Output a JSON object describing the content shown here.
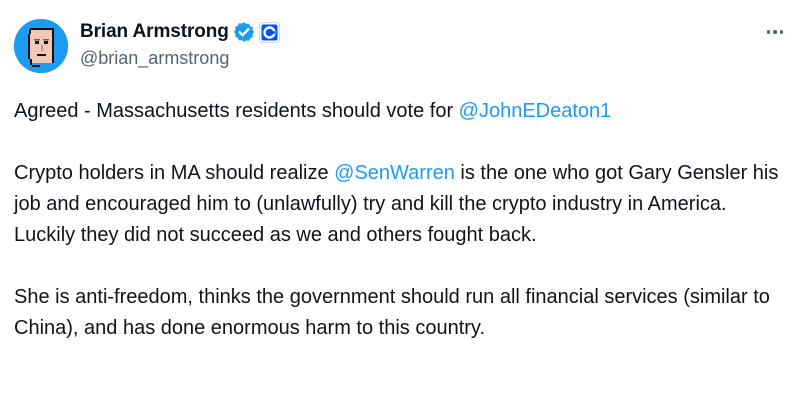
{
  "author": {
    "display_name": "Brian Armstrong",
    "handle": "@brian_armstrong",
    "verified": true,
    "affiliate": "Coinbase",
    "avatar_icon": "pixel-punk-avatar-icon"
  },
  "menu": {
    "icon": "more-icon"
  },
  "tweet": {
    "p1_pre": "Agreed - Massachusetts residents should vote for ",
    "p1_mention": "@JohnEDeaton1",
    "p2_pre": "Crypto holders in MA should realize ",
    "p2_mention": "@SenWarren",
    "p2_post": " is the one who got Gary Gensler his job and encouraged him to (unlawfully) try and kill the crypto industry in America. Luckily they did not succeed as we and others fought back.",
    "p3": "She is anti-freedom, thinks the government should run all financial services (similar to China), and has done enormous harm to this country."
  },
  "colors": {
    "text": "#0f1419",
    "secondary": "#536471",
    "link": "#1d9bf0",
    "verified": "#1d9bf0",
    "affiliate": "#0052ff"
  }
}
